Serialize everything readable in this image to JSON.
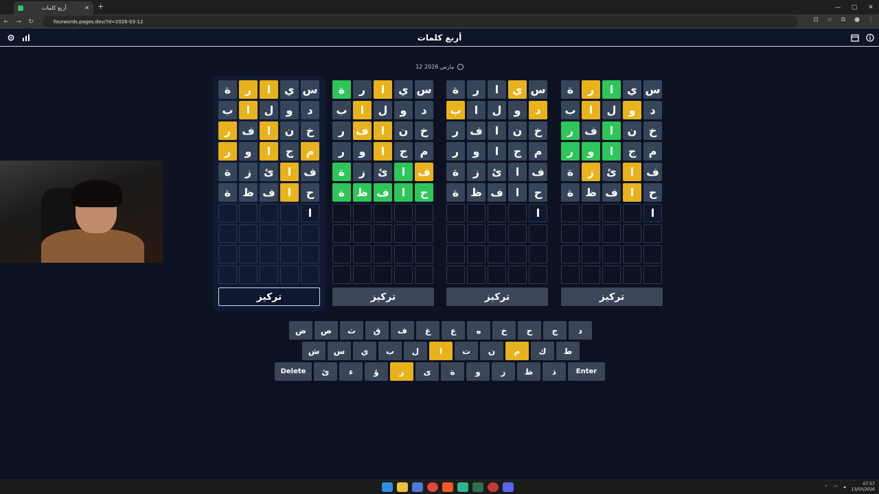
{
  "browser": {
    "tab_title": "أربع كلمات",
    "url": "fourwords.pages.dev/?d=2026-03-12"
  },
  "app": {
    "title": "أربع كلمات",
    "date": "12 مارس 2026"
  },
  "boards": [
    {
      "focus_label": "تركيز",
      "active": true,
      "rows": [
        [
          {
            "l": "س",
            "s": "n"
          },
          {
            "l": "ي",
            "s": "n"
          },
          {
            "l": "ا",
            "s": "y"
          },
          {
            "l": "ر",
            "s": "y"
          },
          {
            "l": "ة",
            "s": "n"
          }
        ],
        [
          {
            "l": "د",
            "s": "n"
          },
          {
            "l": "و",
            "s": "n"
          },
          {
            "l": "ل",
            "s": "n"
          },
          {
            "l": "ا",
            "s": "y"
          },
          {
            "l": "ب",
            "s": "n"
          }
        ],
        [
          {
            "l": "خ",
            "s": "n"
          },
          {
            "l": "ن",
            "s": "n"
          },
          {
            "l": "ا",
            "s": "y"
          },
          {
            "l": "ف",
            "s": "n"
          },
          {
            "l": "ر",
            "s": "y"
          }
        ],
        [
          {
            "l": "م",
            "s": "y"
          },
          {
            "l": "ج",
            "s": "n"
          },
          {
            "l": "ا",
            "s": "y"
          },
          {
            "l": "و",
            "s": "n"
          },
          {
            "l": "ر",
            "s": "y"
          }
        ],
        [
          {
            "l": "ف",
            "s": "n"
          },
          {
            "l": "ا",
            "s": "y"
          },
          {
            "l": "ئ",
            "s": "n"
          },
          {
            "l": "ز",
            "s": "n"
          },
          {
            "l": "ة",
            "s": "n"
          }
        ],
        [
          {
            "l": "ح",
            "s": "n"
          },
          {
            "l": "ا",
            "s": "y"
          },
          {
            "l": "ف",
            "s": "n"
          },
          {
            "l": "ظ",
            "s": "n"
          },
          {
            "l": "ة",
            "s": "n"
          }
        ],
        [
          {
            "l": "ا",
            "s": "t"
          },
          {
            "l": "",
            "s": "e"
          },
          {
            "l": "",
            "s": "e"
          },
          {
            "l": "",
            "s": "e"
          },
          {
            "l": "",
            "s": "e"
          }
        ]
      ]
    },
    {
      "focus_label": "تركيز",
      "active": false,
      "rows": [
        [
          {
            "l": "س",
            "s": "n"
          },
          {
            "l": "ي",
            "s": "n"
          },
          {
            "l": "ا",
            "s": "y"
          },
          {
            "l": "ر",
            "s": "n"
          },
          {
            "l": "ة",
            "s": "g"
          }
        ],
        [
          {
            "l": "د",
            "s": "n"
          },
          {
            "l": "و",
            "s": "n"
          },
          {
            "l": "ل",
            "s": "n"
          },
          {
            "l": "ا",
            "s": "y"
          },
          {
            "l": "ب",
            "s": "n"
          }
        ],
        [
          {
            "l": "خ",
            "s": "n"
          },
          {
            "l": "ن",
            "s": "n"
          },
          {
            "l": "ا",
            "s": "y"
          },
          {
            "l": "ف",
            "s": "y"
          },
          {
            "l": "ر",
            "s": "n"
          }
        ],
        [
          {
            "l": "م",
            "s": "n"
          },
          {
            "l": "ج",
            "s": "n"
          },
          {
            "l": "ا",
            "s": "y"
          },
          {
            "l": "و",
            "s": "n"
          },
          {
            "l": "ر",
            "s": "n"
          }
        ],
        [
          {
            "l": "ف",
            "s": "y"
          },
          {
            "l": "ا",
            "s": "g"
          },
          {
            "l": "ئ",
            "s": "n"
          },
          {
            "l": "ز",
            "s": "n"
          },
          {
            "l": "ة",
            "s": "g"
          }
        ],
        [
          {
            "l": "ح",
            "s": "g"
          },
          {
            "l": "ا",
            "s": "g"
          },
          {
            "l": "ف",
            "s": "g"
          },
          {
            "l": "ظ",
            "s": "g"
          },
          {
            "l": "ة",
            "s": "g"
          }
        ],
        [
          {
            "l": "",
            "s": "e"
          },
          {
            "l": "",
            "s": "e"
          },
          {
            "l": "",
            "s": "e"
          },
          {
            "l": "",
            "s": "e"
          },
          {
            "l": "",
            "s": "e"
          }
        ]
      ]
    },
    {
      "focus_label": "تركيز",
      "active": false,
      "rows": [
        [
          {
            "l": "س",
            "s": "n"
          },
          {
            "l": "ي",
            "s": "y"
          },
          {
            "l": "ا",
            "s": "n"
          },
          {
            "l": "ر",
            "s": "n"
          },
          {
            "l": "ة",
            "s": "n"
          }
        ],
        [
          {
            "l": "د",
            "s": "y"
          },
          {
            "l": "و",
            "s": "n"
          },
          {
            "l": "ل",
            "s": "n"
          },
          {
            "l": "ا",
            "s": "n"
          },
          {
            "l": "ب",
            "s": "y"
          }
        ],
        [
          {
            "l": "خ",
            "s": "n"
          },
          {
            "l": "ن",
            "s": "n"
          },
          {
            "l": "ا",
            "s": "n"
          },
          {
            "l": "ف",
            "s": "n"
          },
          {
            "l": "ر",
            "s": "n"
          }
        ],
        [
          {
            "l": "م",
            "s": "n"
          },
          {
            "l": "ج",
            "s": "n"
          },
          {
            "l": "ا",
            "s": "n"
          },
          {
            "l": "و",
            "s": "n"
          },
          {
            "l": "ر",
            "s": "n"
          }
        ],
        [
          {
            "l": "ف",
            "s": "n"
          },
          {
            "l": "ا",
            "s": "n"
          },
          {
            "l": "ئ",
            "s": "n"
          },
          {
            "l": "ز",
            "s": "n"
          },
          {
            "l": "ة",
            "s": "n"
          }
        ],
        [
          {
            "l": "ح",
            "s": "n"
          },
          {
            "l": "ا",
            "s": "n"
          },
          {
            "l": "ف",
            "s": "n"
          },
          {
            "l": "ظ",
            "s": "n"
          },
          {
            "l": "ة",
            "s": "n"
          }
        ],
        [
          {
            "l": "ا",
            "s": "t"
          },
          {
            "l": "",
            "s": "e"
          },
          {
            "l": "",
            "s": "e"
          },
          {
            "l": "",
            "s": "e"
          },
          {
            "l": "",
            "s": "e"
          }
        ]
      ]
    },
    {
      "focus_label": "تركيز",
      "active": false,
      "rows": [
        [
          {
            "l": "س",
            "s": "n"
          },
          {
            "l": "ي",
            "s": "n"
          },
          {
            "l": "ا",
            "s": "g"
          },
          {
            "l": "ر",
            "s": "y"
          },
          {
            "l": "ة",
            "s": "n"
          }
        ],
        [
          {
            "l": "د",
            "s": "n"
          },
          {
            "l": "و",
            "s": "y"
          },
          {
            "l": "ل",
            "s": "n"
          },
          {
            "l": "ا",
            "s": "y"
          },
          {
            "l": "ب",
            "s": "n"
          }
        ],
        [
          {
            "l": "خ",
            "s": "n"
          },
          {
            "l": "ن",
            "s": "n"
          },
          {
            "l": "ا",
            "s": "g"
          },
          {
            "l": "ف",
            "s": "n"
          },
          {
            "l": "ر",
            "s": "g"
          }
        ],
        [
          {
            "l": "م",
            "s": "n"
          },
          {
            "l": "ج",
            "s": "n"
          },
          {
            "l": "ا",
            "s": "g"
          },
          {
            "l": "و",
            "s": "g"
          },
          {
            "l": "ر",
            "s": "g"
          }
        ],
        [
          {
            "l": "ف",
            "s": "n"
          },
          {
            "l": "ا",
            "s": "y"
          },
          {
            "l": "ئ",
            "s": "n"
          },
          {
            "l": "ز",
            "s": "y"
          },
          {
            "l": "ة",
            "s": "n"
          }
        ],
        [
          {
            "l": "ح",
            "s": "n"
          },
          {
            "l": "ا",
            "s": "y"
          },
          {
            "l": "ف",
            "s": "n"
          },
          {
            "l": "ظ",
            "s": "n"
          },
          {
            "l": "ة",
            "s": "n"
          }
        ],
        [
          {
            "l": "ا",
            "s": "t"
          },
          {
            "l": "",
            "s": "e"
          },
          {
            "l": "",
            "s": "e"
          },
          {
            "l": "",
            "s": "e"
          },
          {
            "l": "",
            "s": "e"
          }
        ]
      ]
    }
  ],
  "keyboard": {
    "row1": [
      {
        "k": "د"
      },
      {
        "k": "ج"
      },
      {
        "k": "ح"
      },
      {
        "k": "خ"
      },
      {
        "k": "ه"
      },
      {
        "k": "ع"
      },
      {
        "k": "غ"
      },
      {
        "k": "ف"
      },
      {
        "k": "ق"
      },
      {
        "k": "ث"
      },
      {
        "k": "ص"
      },
      {
        "k": "ض"
      }
    ],
    "row2": [
      {
        "k": "ط"
      },
      {
        "k": "ك"
      },
      {
        "k": "م",
        "y": true
      },
      {
        "k": "ن"
      },
      {
        "k": "ت"
      },
      {
        "k": "ا",
        "y": true
      },
      {
        "k": "ل"
      },
      {
        "k": "ب"
      },
      {
        "k": "ي"
      },
      {
        "k": "س"
      },
      {
        "k": "ش"
      }
    ],
    "row3": [
      {
        "k": "Enter",
        "w": true
      },
      {
        "k": "ذ"
      },
      {
        "k": "ظ"
      },
      {
        "k": "ز"
      },
      {
        "k": "و"
      },
      {
        "k": "ة"
      },
      {
        "k": "ى"
      },
      {
        "k": "ر",
        "y": true
      },
      {
        "k": "ؤ"
      },
      {
        "k": "ء"
      },
      {
        "k": "ئ"
      },
      {
        "k": "Delete",
        "w": true
      }
    ]
  },
  "taskbar": {
    "time": "07:57",
    "date": "13/03/2026"
  },
  "colors": {
    "present": "#e8b21c",
    "correct": "#2ec55a",
    "absent": "#37455a"
  }
}
